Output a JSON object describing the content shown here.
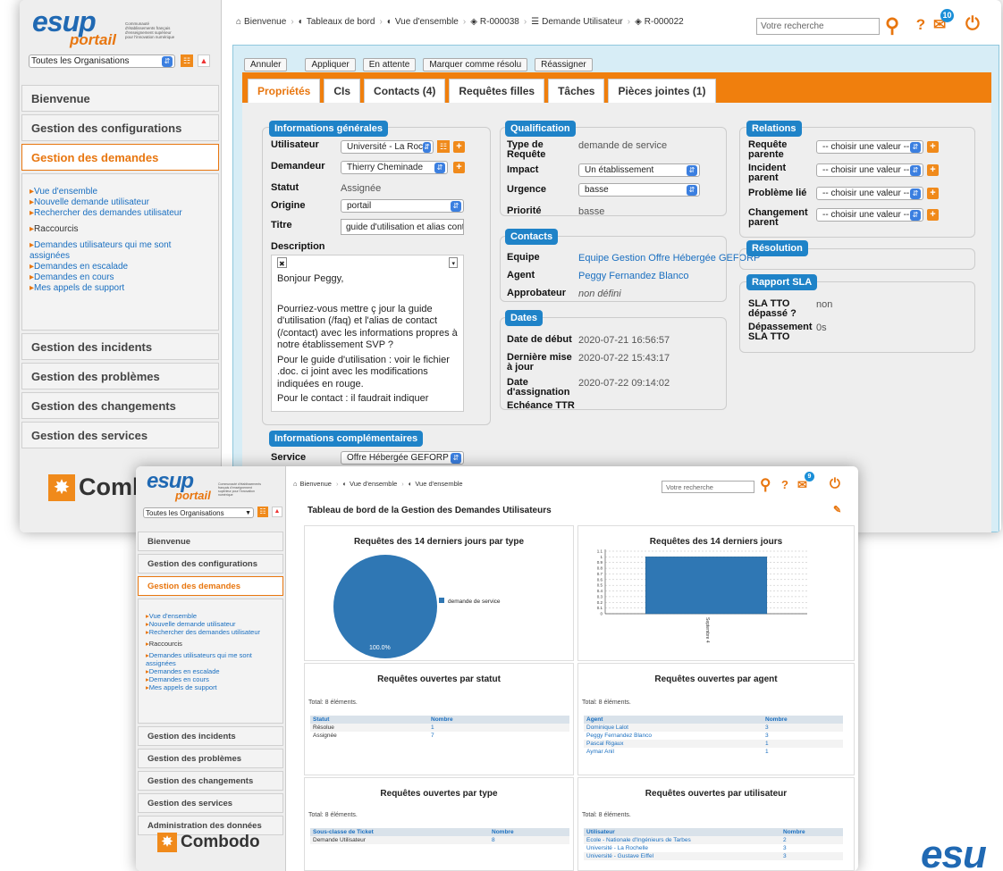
{
  "w1": {
    "logo": {
      "esup": "esup",
      "portail": "portail",
      "sub": "Communauté d'établissements français d'enseignement supérieur pour l'innovation numérique"
    },
    "org_select": "Toutes les Organisations",
    "menu": [
      "Bienvenue",
      "Gestion des configurations",
      "Gestion des demandes",
      "Gestion des incidents",
      "Gestion des problèmes",
      "Gestion des changements",
      "Gestion des services"
    ],
    "submenu": {
      "links1": [
        "Vue d'ensemble",
        "Nouvelle demande utilisateur",
        "Rechercher des demandes utilisateur"
      ],
      "raccourcis": "Raccourcis",
      "links2": [
        "Demandes utilisateurs qui me sont assignées",
        "Demandes en escalade",
        "Demandes en cours",
        "Mes appels de support"
      ]
    },
    "combodo": "Comb",
    "breadcrumb": [
      "Bienvenue",
      "Tableaux de bord",
      "Vue d'ensemble",
      "R-000038",
      "Demande Utilisateur",
      "R-000022"
    ],
    "search_placeholder": "Votre recherche",
    "notif_count": "10",
    "actions": [
      "Annuler",
      "Appliquer",
      "En attente",
      "Marquer comme résolu",
      "Réassigner"
    ],
    "tabs": [
      "Propriétés",
      "CIs",
      "Contacts (4)",
      "Requêtes filles",
      "Tâches",
      "Pièces jointes (1)"
    ],
    "info_gen": {
      "legend": "Informations générales",
      "utilisateur_l": "Utilisateur",
      "utilisateur_v": "Université - La Roc",
      "demandeur_l": "Demandeur",
      "demandeur_v": "Thierry Cheminade",
      "statut_l": "Statut",
      "statut_v": "Assignée",
      "origine_l": "Origine",
      "origine_v": "portail",
      "titre_l": "Titre",
      "titre_v": "guide d'utilisation et alias conta",
      "description_l": "Description",
      "description": [
        "Bonjour Peggy,",
        "",
        "Pourriez-vous mettre ç jour la guide d'utilisation (/faq) et l'alias de contact (/contact) avec les informations propres à notre établissement SVP ?",
        "Pour le guide d'utilisation : voir le fichier .doc. ci joint avec les modifications indiquées en rouge.",
        "Pour le contact : il faudrait indiquer"
      ]
    },
    "info_comp": {
      "legend": "Informations complémentaires",
      "service_l": "Service",
      "service_v": "Offre Hébergée GEFORP"
    },
    "qualif": {
      "legend": "Qualification",
      "type_l": "Type de Requête",
      "type_v": "demande de service",
      "impact_l": "Impact",
      "impact_v": "Un établissement",
      "urgence_l": "Urgence",
      "urgence_v": "basse",
      "priorite_l": "Priorité",
      "priorite_v": "basse"
    },
    "contacts": {
      "legend": "Contacts",
      "equipe_l": "Equipe",
      "equipe_v": "Equipe Gestion Offre Hébergée GEFORP",
      "agent_l": "Agent",
      "agent_v": "Peggy Fernandez Blanco",
      "approb_l": "Approbateur",
      "approb_v": "non défini"
    },
    "dates": {
      "legend": "Dates",
      "debut_l": "Date de début",
      "debut_v": "2020-07-21 16:56:57",
      "maj_l": "Dernière mise à jour",
      "maj_v": "2020-07-22 15:43:17",
      "assign_l": "Date d'assignation",
      "assign_v": "2020-07-22 09:14:02",
      "ttr_l": "Echéance TTR"
    },
    "relations": {
      "legend": "Relations",
      "parente_l": "Requête parente",
      "incident_l": "Incident parent",
      "probleme_l": "Problème lié",
      "changement_l": "Changement parent",
      "choose": "-- choisir une valeur --"
    },
    "resolution": {
      "legend": "Résolution"
    },
    "sla": {
      "legend": "Rapport SLA",
      "tto_l": "SLA TTO dépassé ?",
      "tto_v": "non",
      "dep_l": "Dépassement SLA TTO",
      "dep_v": "0s"
    }
  },
  "w2": {
    "logo": {
      "esup": "esup",
      "portail": "portail",
      "sub": "Communauté d'établissements français d'enseignement supérieur pour l'innovation numérique"
    },
    "org_select": "Toutes les Organisations",
    "menu": [
      "Bienvenue",
      "Gestion des configurations",
      "Gestion des demandes",
      "Gestion des incidents",
      "Gestion des problèmes",
      "Gestion des changements",
      "Gestion des services",
      "Administration des données"
    ],
    "submenu": {
      "links1": [
        "Vue d'ensemble",
        "Nouvelle demande utilisateur",
        "Rechercher des demandes utilisateur"
      ],
      "raccourcis": "Raccourcis",
      "links2": [
        "Demandes utilisateurs qui me sont assignées",
        "Demandes en escalade",
        "Demandes en cours",
        "Mes appels de support"
      ]
    },
    "combodo": "Combodo",
    "breadcrumb": [
      "Bienvenue",
      "Vue d'ensemble",
      "Vue d'ensemble"
    ],
    "search_placeholder": "Votre recherche",
    "notif_count": "9",
    "dashboard_title": "Tableau de bord de la Gestion des Demandes Utilisateurs",
    "cards": {
      "pie_title": "Requêtes des 14 derniers jours par type",
      "bar_title": "Requêtes des 14 derniers jours",
      "statut_title": "Requêtes ouvertes par statut",
      "agent_title": "Requêtes ouvertes par agent",
      "type_title": "Requêtes ouvertes par type",
      "user_title": "Requêtes ouvertes par utilisateur",
      "total": "Total: 8 éléments."
    },
    "tables": {
      "statut": {
        "headers": [
          "Statut",
          "Nombre"
        ],
        "rows": [
          [
            "Résolue",
            "1"
          ],
          [
            "Assignée",
            "7"
          ]
        ]
      },
      "agent": {
        "headers": [
          "Agent",
          "Nombre"
        ],
        "rows": [
          [
            "Dominique Lalot",
            "3"
          ],
          [
            "Peggy Fernandez Blanco",
            "3"
          ],
          [
            "Pascal Rigaux",
            "1"
          ],
          [
            "Aymar Anil",
            "1"
          ]
        ]
      },
      "type": {
        "headers": [
          "Sous-classe de Ticket",
          "Nombre"
        ],
        "rows": [
          [
            "Demande Utilisateur",
            "8"
          ]
        ]
      },
      "user": {
        "headers": [
          "Utilisateur",
          "Nombre"
        ],
        "rows": [
          [
            "Ecole - Nationale d'Ingénieurs de Tarbes",
            "2"
          ],
          [
            "Université - La Rochelle",
            "3"
          ],
          [
            "Université - Gustave Eiffel",
            "3"
          ]
        ]
      }
    }
  },
  "chart_data": [
    {
      "type": "pie",
      "title": "Requêtes des 14 derniers jours par type",
      "categories": [
        "demande de service"
      ],
      "values": [
        100.0
      ],
      "labels": [
        "100.0%"
      ],
      "legend": "right",
      "color": "#2f77b4"
    },
    {
      "type": "bar",
      "title": "Requêtes des 14 derniers jours",
      "categories": [
        "Septembre 4"
      ],
      "values": [
        1
      ],
      "ylim": [
        0,
        1.1
      ],
      "yticks": [
        "0",
        "0.1",
        "0.2",
        "0.3",
        "0.4",
        "0.5",
        "0.6",
        "0.7",
        "0.8",
        "0.9",
        "1",
        "1.1"
      ],
      "grid": true,
      "color": "#2f77b4"
    }
  ],
  "colors": {
    "accent": "#e8760f",
    "blue": "#1f83c8",
    "content_bg": "#d7edf6"
  },
  "esup_corner": "esu"
}
